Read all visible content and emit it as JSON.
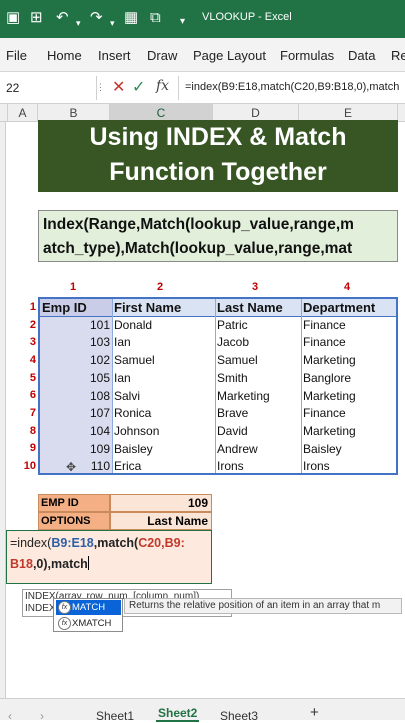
{
  "titlebar": {
    "title": "VLOOKUP - Excel",
    "icons": [
      "save-icon",
      "table-icon",
      "undo-icon",
      "redo-icon",
      "grid-icon",
      "hierarchy-icon",
      "dropdown-icon"
    ]
  },
  "ribbon": {
    "tabs": [
      "File",
      "Home",
      "Insert",
      "Draw",
      "Page Layout",
      "Formulas",
      "Data",
      "Re"
    ]
  },
  "formula_bar": {
    "name_box": "22",
    "fx_label": "fx",
    "formula": "=index(B9:E18,match(C20,B9:B18,0),match"
  },
  "columns": [
    "A",
    "B",
    "C",
    "D",
    "E"
  ],
  "banner": {
    "line1": "Using INDEX & Match",
    "line2": "Function Together"
  },
  "syntax": {
    "line1": "Index(Range,Match(lookup_value,range,m",
    "line2": "atch_type),Match(lookup_value,range,mat"
  },
  "col_indices": [
    "1",
    "2",
    "3",
    "4"
  ],
  "row_indices": [
    "1",
    "2",
    "3",
    "4",
    "5",
    "6",
    "7",
    "8",
    "9",
    "10"
  ],
  "table": {
    "headers": [
      "Emp ID",
      "First Name",
      "Last Name",
      "Department"
    ],
    "rows": [
      [
        "101",
        "Donald",
        "Patric",
        "Finance"
      ],
      [
        "103",
        "Ian",
        "Jacob",
        "Finance"
      ],
      [
        "102",
        "Samuel",
        "Samuel",
        "Marketing"
      ],
      [
        "105",
        "Ian",
        "Smith",
        "Banglore"
      ],
      [
        "108",
        "Salvi",
        "Marketing",
        "Marketing"
      ],
      [
        "107",
        "Ronica",
        "Brave",
        "Finance"
      ],
      [
        "104",
        "Johnson",
        "David",
        "Marketing"
      ],
      [
        "109",
        "Baisley",
        "Andrew",
        "Baisley"
      ],
      [
        "110",
        "Erica",
        "Irons",
        "Irons"
      ]
    ]
  },
  "lookup": {
    "emp_id_label": "EMP ID",
    "emp_id_value": "109",
    "options_label": "OPTIONS",
    "options_value": "Last Name"
  },
  "editor": {
    "part1": "=index(",
    "part2": "B9:E18",
    "part3": ",match(",
    "part4": "C20",
    "part5": ",B9:",
    "part6": "B18",
    "part7": ",0),match"
  },
  "tooltip": {
    "line1": "INDEX(array, row_num, [column_num])",
    "line2": "INDEX"
  },
  "autocomplete": {
    "items": [
      "MATCH",
      "XMATCH"
    ],
    "description": "Returns the relative position of an item in an array that m"
  },
  "sheet_tabs": [
    "Sheet1",
    "Sheet2",
    "Sheet3"
  ],
  "add_sheet": "+",
  "colors": {
    "excel_green": "#217346",
    "banner_green": "#375623",
    "syntax_fill": "#e2efda",
    "table_border": "#4472c4",
    "index_red": "#c00000",
    "lookup_orange": "#f4b084"
  }
}
